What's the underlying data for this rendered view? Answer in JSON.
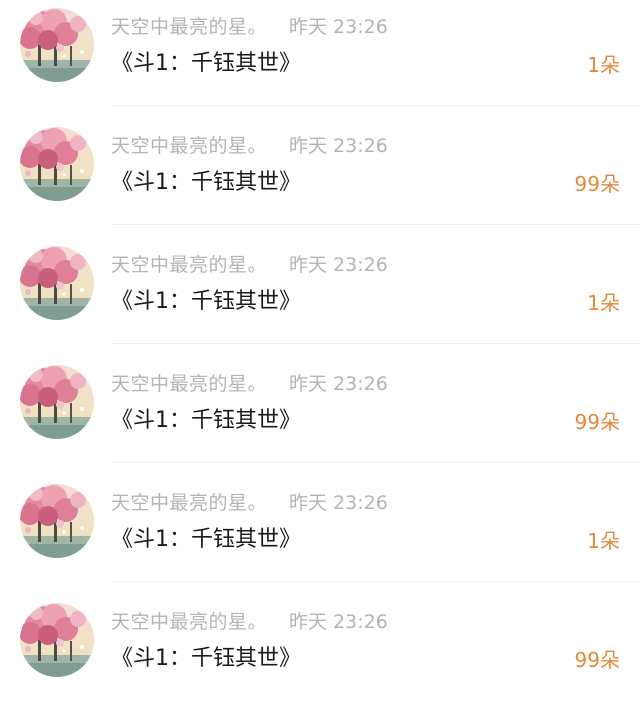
{
  "items": [
    {
      "name": "天空中最亮的星。",
      "time": "昨天 23:26",
      "gift": "《斗1：千钰其世》",
      "count": "1朵"
    },
    {
      "name": "天空中最亮的星。",
      "time": "昨天 23:26",
      "gift": "《斗1：千钰其世》",
      "count": "99朵"
    },
    {
      "name": "天空中最亮的星。",
      "time": "昨天 23:26",
      "gift": "《斗1：千钰其世》",
      "count": "1朵"
    },
    {
      "name": "天空中最亮的星。",
      "time": "昨天 23:26",
      "gift": "《斗1：千钰其世》",
      "count": "99朵"
    },
    {
      "name": "天空中最亮的星。",
      "time": "昨天 23:26",
      "gift": "《斗1：千钰其世》",
      "count": "1朵"
    },
    {
      "name": "天空中最亮的星。",
      "time": "昨天 23:26",
      "gift": "《斗1：千钰其世》",
      "count": "99朵"
    }
  ],
  "colors": {
    "meta_text": "#b4b4b4",
    "title_text": "#1a1a1a",
    "count_accent": "#e4883a",
    "divider": "#f0f0f0"
  }
}
